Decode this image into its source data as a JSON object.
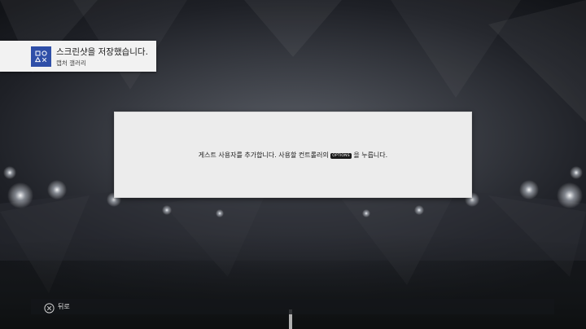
{
  "notification": {
    "title": "스크린샷을 저장했습니다.",
    "subtitle": "캡처 갤러리",
    "icon": "capture-gallery-icon",
    "icon_bg_color": "#2f4fa8"
  },
  "dialog": {
    "message_before": "게스트 사용자를 추가합니다. 사용할 컨트롤러의",
    "button_glyph": "OPTIONS",
    "message_after": "을 누릅니다."
  },
  "footer": {
    "back_icon": "cross-button-icon",
    "back_label": "뒤로"
  }
}
